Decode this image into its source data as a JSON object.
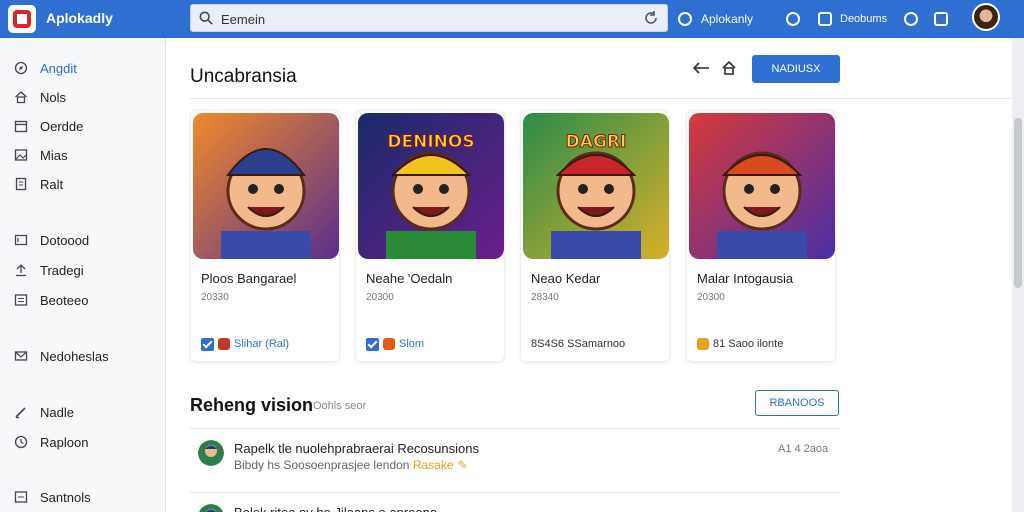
{
  "app": {
    "title": "Aplokadly"
  },
  "search": {
    "value": "Eemein",
    "placeholder": ""
  },
  "topbar": {
    "account_label": "Aplokanly",
    "docs_label": "Deobums"
  },
  "sidebar": {
    "items": [
      {
        "label": "Angdit",
        "icon": "compass-icon"
      },
      {
        "label": "Nols",
        "icon": "home-icon"
      },
      {
        "label": "Oerdde",
        "icon": "calendar-icon"
      },
      {
        "label": "Mias",
        "icon": "image-icon"
      },
      {
        "label": "Ralt",
        "icon": "document-icon"
      },
      {
        "label": "Dotoood",
        "icon": "folder-icon"
      },
      {
        "label": "Tradegi",
        "icon": "upload-icon"
      },
      {
        "label": "Beoteeo",
        "icon": "list-icon"
      },
      {
        "label": "Nedoheslas",
        "icon": "mail-icon"
      },
      {
        "label": "Nadle",
        "icon": "edit-icon"
      },
      {
        "label": "Raploon",
        "icon": "clock-icon"
      },
      {
        "label": "Santnols",
        "icon": "settings-icon"
      }
    ]
  },
  "main": {
    "section1_title": "Uncabransia",
    "primary_button": "NADIUSX",
    "cards": [
      {
        "name": "Ploos Bangarael",
        "sub": "20330",
        "meta": "Slihar (Ral)"
      },
      {
        "name": "Neahe 'Oedaln",
        "sub": "20300",
        "meta": "Slom"
      },
      {
        "name": "Neao Kedar",
        "sub": "28340",
        "meta": "8S4S6 SSamarnoo"
      },
      {
        "name": "Malar Intogausia",
        "sub": "20300",
        "meta": "81  Saoo ilonte"
      }
    ],
    "card_art": [
      {
        "banner": "",
        "bg1": "#f08a2c",
        "bg2": "#5a2e8c"
      },
      {
        "banner": "DENINOS",
        "bg1": "#1a2a6c",
        "bg2": "#6a1f8a"
      },
      {
        "banner": "DAGRI",
        "bg1": "#2a8c4a",
        "bg2": "#d8b02a"
      },
      {
        "banner": "",
        "bg1": "#d8393a",
        "bg2": "#4a2ea6"
      }
    ],
    "section2_title": "Reheng vision",
    "section2_sub": "Oohls seor",
    "section2_button": "RBANOOS",
    "list": [
      {
        "title": "Rapelk tle nuolehprabraerai Recosunsions",
        "sub": "Bibdy  hs  Soosoenprasjee lendon",
        "tag": "Rasake",
        "time": "A1  4  2aoa"
      },
      {
        "title": "Bolok ritea oy ho Jilaans e apreone",
        "sub": "",
        "tag": "",
        "time": ""
      }
    ]
  },
  "colors": {
    "accent": "#2f6fd1",
    "tag": "#e8a01e",
    "logo_red": "#d8262b"
  }
}
